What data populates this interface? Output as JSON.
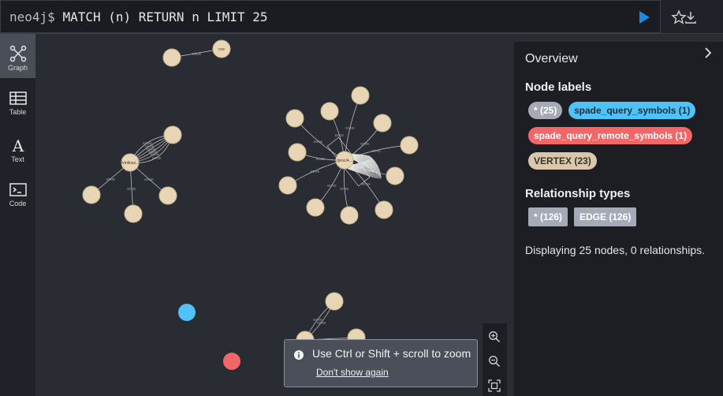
{
  "query": {
    "prompt": "neo4j$",
    "text": "MATCH (n) RETURN n LIMIT 25"
  },
  "toolbar": {
    "run_icon": "play-icon",
    "favorite_icon": "star-icon",
    "download_icon": "download-icon"
  },
  "sidebar": {
    "items": [
      {
        "label": "Graph",
        "icon": "graph-icon",
        "active": true
      },
      {
        "label": "Table",
        "icon": "table-icon",
        "active": false
      },
      {
        "label": "Text",
        "icon": "text-icon",
        "active": false
      },
      {
        "label": "Code",
        "icon": "code-icon",
        "active": false
      }
    ]
  },
  "overview": {
    "title": "Overview",
    "node_labels_heading": "Node labels",
    "node_labels": [
      {
        "text": "* (25)",
        "color": "#a5abb6"
      },
      {
        "text": "spade_query_symbols (1)",
        "color": "#4fc3f7"
      },
      {
        "text": "spade_query_remote_symbols (1)",
        "color": "#f16667"
      },
      {
        "text": "VERTEX (23)",
        "color": "#d9c8ae"
      }
    ],
    "rel_types_heading": "Relationship types",
    "rel_types": [
      {
        "text": "* (126)",
        "color": "#a5abb6"
      },
      {
        "text": "EDGE (126)",
        "color": "#a5abb6"
      }
    ],
    "description": "Displaying 25 nodes, 0 relationships."
  },
  "graph": {
    "node_color": "#e8d5b5",
    "node_stroke": "#c9b48f",
    "blue_node_color": "#4fc3f7",
    "red_node_color": "#f16667",
    "edge_color": "#cfcfcf",
    "edge_label": "EDGE",
    "node_captions": {
      "top_right": "cce",
      "left_hub": "/vmlinux...",
      "center_hub": "/proc/4..."
    }
  },
  "toast": {
    "message": "Use Ctrl or Shift + scroll to zoom",
    "link": "Don't show again"
  },
  "colors": {
    "run_button": "#1e88e5",
    "panel_bg": "#1c1e23",
    "canvas_bg": "#292c33"
  }
}
